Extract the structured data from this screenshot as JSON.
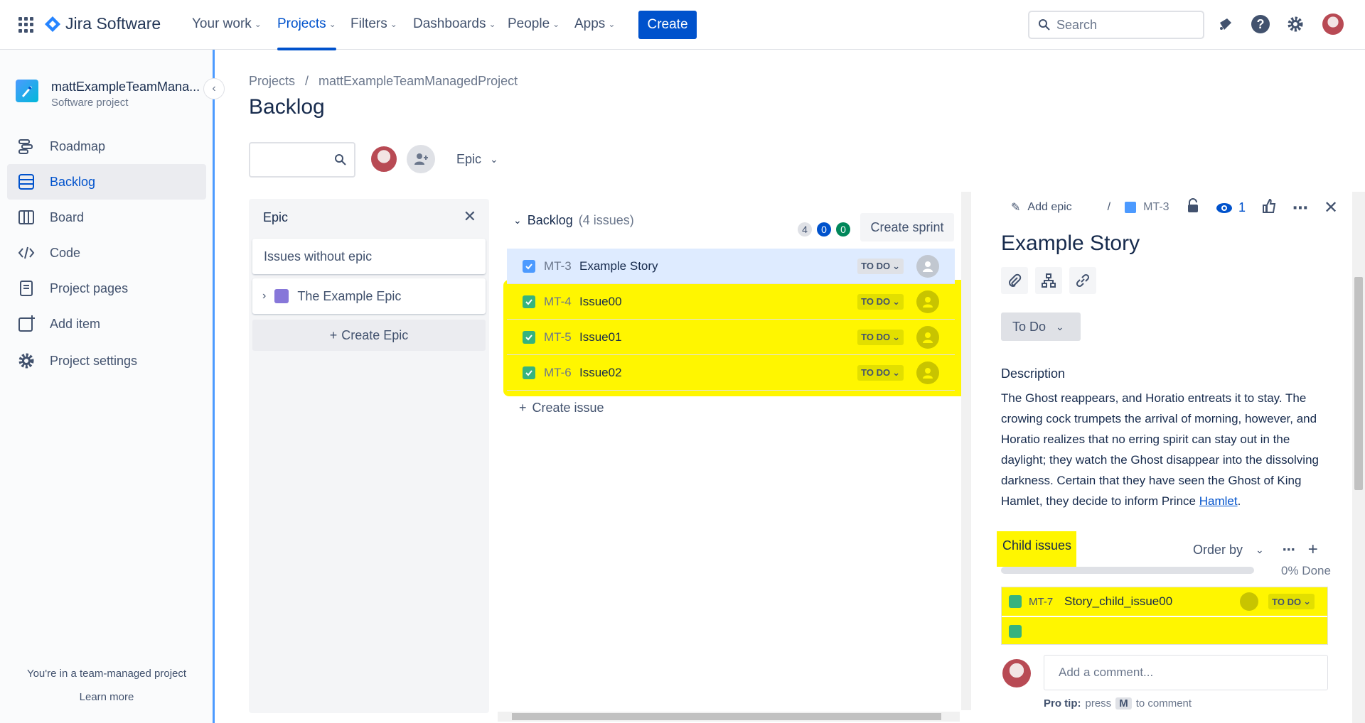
{
  "nav": {
    "product": "Jira Software",
    "items": [
      {
        "label": "Your work"
      },
      {
        "label": "Projects"
      },
      {
        "label": "Filters"
      },
      {
        "label": "Dashboards"
      },
      {
        "label": "People"
      },
      {
        "label": "Apps"
      }
    ],
    "create_label": "Create",
    "search_placeholder": "Search"
  },
  "sidebar": {
    "project_name": "mattExampleTeamMana...",
    "project_type": "Software project",
    "items": [
      {
        "label": "Roadmap"
      },
      {
        "label": "Backlog"
      },
      {
        "label": "Board"
      },
      {
        "label": "Code"
      },
      {
        "label": "Project pages"
      },
      {
        "label": "Add item"
      },
      {
        "label": "Project settings"
      }
    ],
    "footer_text": "You're in a team-managed project",
    "learn_more": "Learn more"
  },
  "main": {
    "breadcrumb": [
      "Projects",
      "/",
      "mattExampleTeamManagedProject"
    ],
    "title": "Backlog",
    "epic_filter_label": "Epic",
    "epic_panel": {
      "title": "Epic",
      "issues_without_epic": "Issues without epic",
      "epic_name": "The Example Epic",
      "create_epic": "Create Epic",
      "epic_color": "#8777d9"
    },
    "backlog": {
      "title": "Backlog",
      "count": "(4 issues)",
      "pills": [
        "4",
        "0",
        "0"
      ],
      "create_sprint": "Create sprint",
      "create_issue": "Create issue",
      "issues": [
        {
          "key": "MT-3",
          "summary": "Example Story",
          "status": "TO DO"
        },
        {
          "key": "MT-4",
          "summary": "Issue00",
          "status": "TO DO"
        },
        {
          "key": "MT-5",
          "summary": "Issue01",
          "status": "TO DO"
        },
        {
          "key": "MT-6",
          "summary": "Issue02",
          "status": "TO DO"
        }
      ]
    }
  },
  "detail": {
    "add_epic": "Add epic",
    "separator": "/",
    "issue_key": "MT-3",
    "watchers": "1",
    "title": "Example Story",
    "status": "To Do",
    "description_label": "Description",
    "description_text": "The Ghost reappears, and Horatio entreats it to stay. The crowing cock trumpets the arrival of morning, however, and Horatio realizes that no erring spirit can stay out in the daylight; they watch the Ghost disappear into the dissolving darkness. Certain that they have seen the Ghost of King Hamlet, they decide to inform Prince",
    "description_link": "Hamlet",
    "description_end": ".",
    "child_issues_label": "Child issues",
    "order_by": "Order by",
    "progress_text": "0% Done",
    "progress": 0,
    "children": [
      {
        "key": "MT-7",
        "summary": "Story_child_issue00",
        "status": "TO DO"
      }
    ],
    "comment_placeholder": "Add a comment...",
    "protip_prefix": "Pro tip:",
    "protip_press": "press",
    "protip_key": "M",
    "protip_suffix": "to comment"
  },
  "colors": {
    "brand": "#0052cc",
    "highlight": "#fff600",
    "sidebar_accent": "#4c9aff"
  }
}
